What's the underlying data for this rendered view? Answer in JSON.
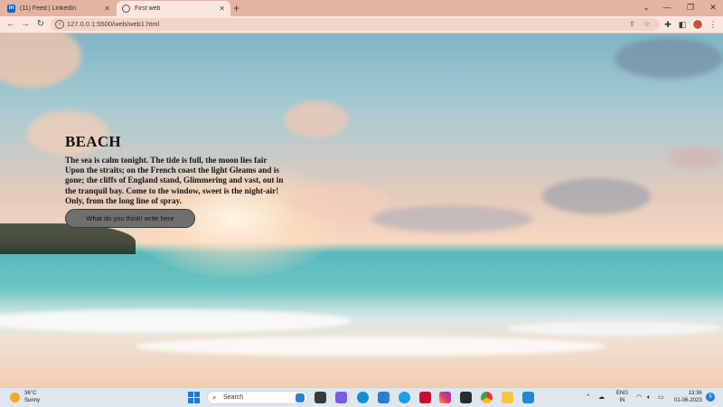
{
  "browser": {
    "tabs": [
      {
        "label": "(11) Feed | LinkedIn",
        "favicon": "linkedin-icon"
      },
      {
        "label": "First web",
        "favicon": "globe-icon"
      }
    ],
    "url": "127.0.0.1:5500/web/web1.html",
    "new_tab_symbol": "+"
  },
  "page": {
    "title": "BEACH",
    "poem": "The sea is calm tonight. The tide is full, the moon lies fair Upon the straits; on the French coast the light Gleams and is gone; the cliffs of England stand, Glimmering and vast, out in the tranquil bay. Come to the window, sweet is the night-air! Only, from the long line of spray.",
    "button_label": "What do you think! write here"
  },
  "taskbar": {
    "weather_temp": "36°C",
    "weather_desc": "Sunny",
    "search_placeholder": "Search",
    "lang_line1": "ENG",
    "lang_line2": "IN",
    "time": "13:36",
    "date": "01-06-2023",
    "notification_count": "5"
  },
  "colors": {
    "tabstrip": "#e4b3a1",
    "toolbar": "#fbe6de",
    "button_bg": "#6f6f6f",
    "taskbar": "#dfe7ee"
  }
}
